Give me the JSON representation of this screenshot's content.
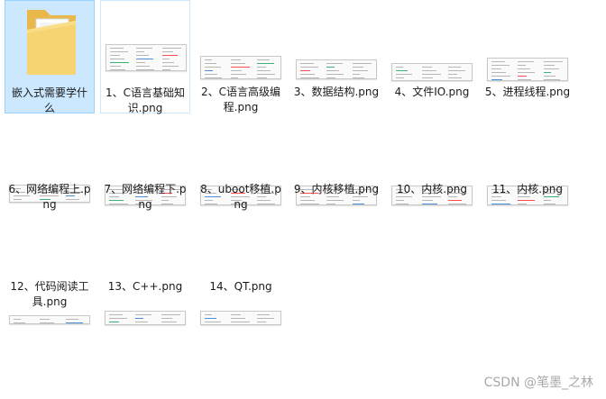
{
  "items": [
    {
      "label": "嵌入式需要学什么",
      "kind": "folder",
      "state": "selected"
    },
    {
      "label": "1、C语言基础知识.png",
      "kind": "image",
      "state": "hover"
    },
    {
      "label": "2、C语言高级编程.png",
      "kind": "image"
    },
    {
      "label": "3、数据结构.png",
      "kind": "image"
    },
    {
      "label": "4、文件IO.png",
      "kind": "image"
    },
    {
      "label": "5、进程线程.png",
      "kind": "image"
    },
    {
      "label": "6、网络编程上.png",
      "kind": "image"
    },
    {
      "label": "7、网络编程下.png",
      "kind": "image"
    },
    {
      "label": "8、uboot移植.png",
      "kind": "image"
    },
    {
      "label": "9、内核移植.png",
      "kind": "image"
    },
    {
      "label": "10、内核.png",
      "kind": "image"
    },
    {
      "label": "11、内核.png",
      "kind": "image"
    },
    {
      "label": "12、代码阅读工具.png",
      "kind": "image"
    },
    {
      "label": "13、C++.png",
      "kind": "image"
    },
    {
      "label": "14、QT.png",
      "kind": "image"
    }
  ],
  "colors": {
    "selection": "#cce8ff",
    "thumb_accents": [
      "#ff4d4d",
      "#3cb371",
      "#4a90d9"
    ]
  },
  "watermark": "CSDN @笔墨_之林"
}
